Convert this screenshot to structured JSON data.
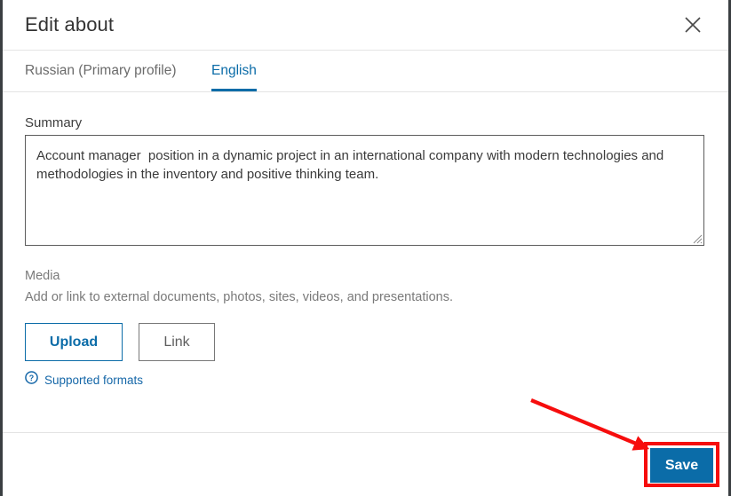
{
  "window": {
    "edge_color": "#3b3f42"
  },
  "header": {
    "title": "Edit about",
    "close_icon": "close-icon"
  },
  "tabs": {
    "items": [
      {
        "label": "Russian (Primary profile)",
        "active": false
      },
      {
        "label": "English",
        "active": true
      }
    ],
    "active_color": "#0b6ca8"
  },
  "summary": {
    "label": "Summary",
    "value": "Account manager  position in a dynamic project in an international company with modern technologies and methodologies in the inventory and positive thinking team.",
    "placeholder": ""
  },
  "media": {
    "label": "Media",
    "help_text": "Add or link to external documents, photos, sites, videos, and presentations.",
    "upload_label": "Upload",
    "link_label": "Link",
    "supported_formats_label": "Supported formats",
    "supported_formats_icon": "question-circle-icon",
    "link_color": "#1567a8"
  },
  "footer": {
    "save_label": "Save",
    "save_bg": "#0b6ca8"
  },
  "annotations": {
    "highlight_color": "#f60d0d",
    "arrow_from": "598,451",
    "arrow_to": "728,506",
    "target": "save-button"
  }
}
